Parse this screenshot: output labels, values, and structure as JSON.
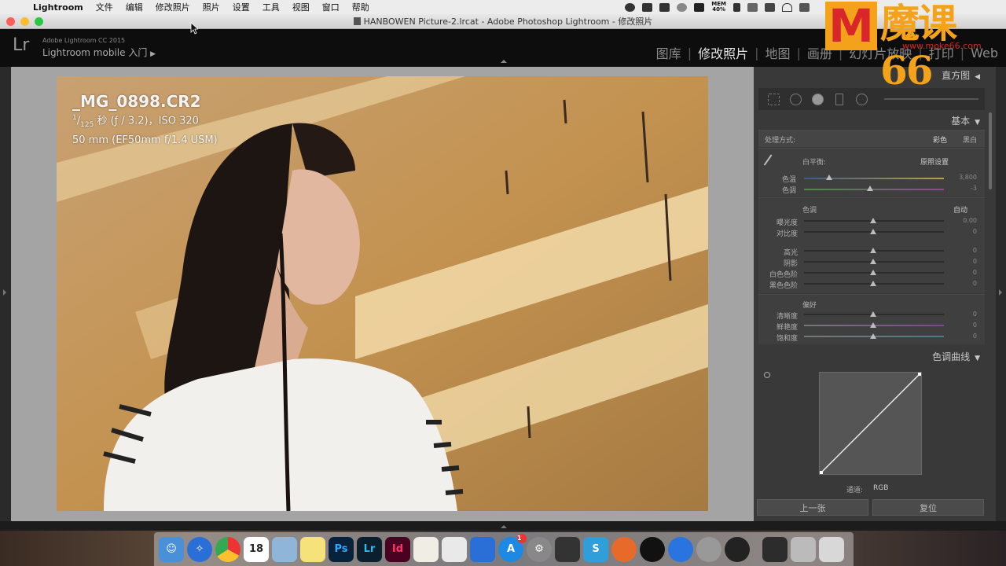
{
  "menubar": {
    "app": "Lightroom",
    "items": [
      "文件",
      "编辑",
      "修改照片",
      "照片",
      "设置",
      "工具",
      "视图",
      "窗口",
      "帮助"
    ],
    "mem_label": "MEM",
    "mem_value": "40%"
  },
  "watermark": {
    "text": "魔课66",
    "logo": "M",
    "url": "www.moke66.com"
  },
  "window": {
    "title": "HANBOWEN Picture-2.lrcat - Adobe Photoshop Lightroom - 修改照片"
  },
  "lr": {
    "logo": "Lr",
    "version": "Adobe Lightroom CC 2015",
    "mobile": "Lightroom mobile 入门",
    "modules": [
      "图库",
      "修改照片",
      "地图",
      "画册",
      "幻灯片放映",
      "打印",
      "Web"
    ],
    "active_module": "修改照片"
  },
  "photo": {
    "filename": "_MG_0898.CR2",
    "shutter_num": "1",
    "shutter_den": "125",
    "exposure": "秒 (ƒ / 3.2)，ISO 320",
    "lens": "50 mm (EF50mm f/1.4 USM)"
  },
  "panel": {
    "histogram_label": "直方图",
    "basic_label": "基本",
    "treatment_label": "处理方式:",
    "color_label": "彩色",
    "bw_label": "黑白",
    "wb_label": "白平衡:",
    "wb_value": "原照设置",
    "temp_label": "色温",
    "temp_value": "3,800",
    "tint_label": "色调",
    "tint_value": "-3",
    "tone_label": "色调",
    "auto_label": "自动",
    "exposure_label": "曝光度",
    "exposure_value": "0.00",
    "contrast_label": "对比度",
    "contrast_value": "0",
    "highlights_label": "高光",
    "highlights_value": "0",
    "shadows_label": "阴影",
    "shadows_value": "0",
    "whites_label": "白色色阶",
    "whites_value": "0",
    "blacks_label": "黑色色阶",
    "blacks_value": "0",
    "presence_label": "偏好",
    "clarity_label": "清晰度",
    "clarity_value": "0",
    "vibrance_label": "鲜艳度",
    "vibrance_value": "0",
    "saturation_label": "饱和度",
    "saturation_value": "0",
    "tone_curve_label": "色调曲线",
    "channel_label": "通道:",
    "channel_value": "RGB",
    "prev_button": "上一张",
    "reset_button": "复位"
  },
  "dock": {
    "calendar_date": "18",
    "notification_badge": "1",
    "icons": [
      "finder-icon",
      "safari-icon",
      "chrome-icon",
      "calendar-icon",
      "preview-icon",
      "notes-icon",
      "photoshop-icon",
      "lightroom-icon",
      "indesign-icon",
      "textedit-icon",
      "numbers-icon",
      "keynote-icon",
      "appstore-icon",
      "system-preferences-icon",
      "final-cut-icon",
      "snagit-icon",
      "weibo-icon",
      "qq-icon",
      "baidu-icon",
      "launchpad-icon",
      "obs-icon",
      "terminal-icon",
      "printer-icon",
      "trash-icon"
    ]
  }
}
